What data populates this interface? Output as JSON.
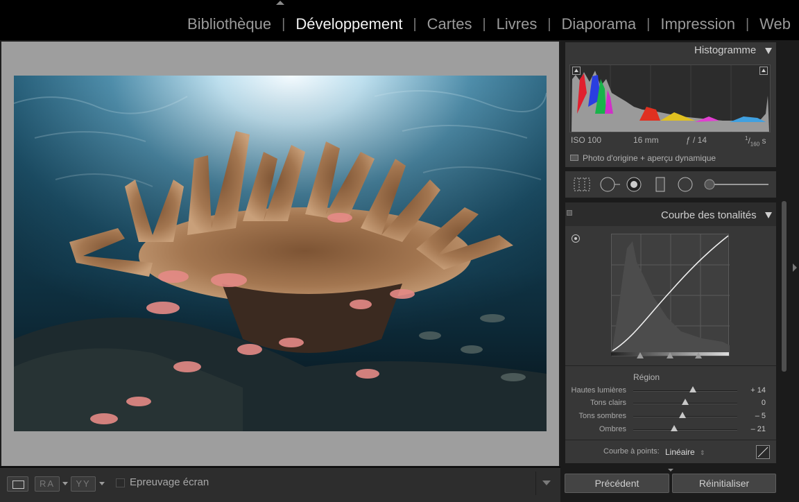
{
  "modules": [
    "Bibliothèque",
    "Développement",
    "Cartes",
    "Livres",
    "Diaporama",
    "Impression",
    "Web"
  ],
  "active_module": "Développement",
  "histogram": {
    "title": "Histogramme",
    "iso": "ISO 100",
    "focal": "16 mm",
    "aperture": "ƒ / 14",
    "shutter_num": "1",
    "shutter_den": "160",
    "shutter_unit": "s",
    "preview_label": "Photo d'origine + aperçu dynamique"
  },
  "tools": [
    "crop-overlay-icon",
    "spot-removal-icon",
    "red-eye-icon",
    "graduated-filter-icon",
    "radial-filter-icon",
    "adjustment-brush-icon"
  ],
  "tone_curve": {
    "title": "Courbe des tonalités",
    "region_label": "Région",
    "rows": [
      {
        "label": "Hautes lumières",
        "value": "+ 14",
        "level": 0.57
      },
      {
        "label": "Tons clairs",
        "value": "0",
        "level": 0.5
      },
      {
        "label": "Tons sombres",
        "value": "– 5",
        "level": 0.475
      },
      {
        "label": "Ombres",
        "value": "– 21",
        "level": 0.395
      }
    ],
    "point_curve_label": "Courbe à points:",
    "point_curve_value": "Linéaire"
  },
  "buttons": {
    "previous": "Précédent",
    "reset": "Réinitialiser"
  },
  "toolbar": {
    "ra": "RA",
    "yy": "YY",
    "softproof": "Epreuvage écran"
  },
  "colors": {
    "accent_active": "#f2f2f2",
    "panel_bg": "#373737",
    "canvas_bg": "#9e9e9e"
  }
}
